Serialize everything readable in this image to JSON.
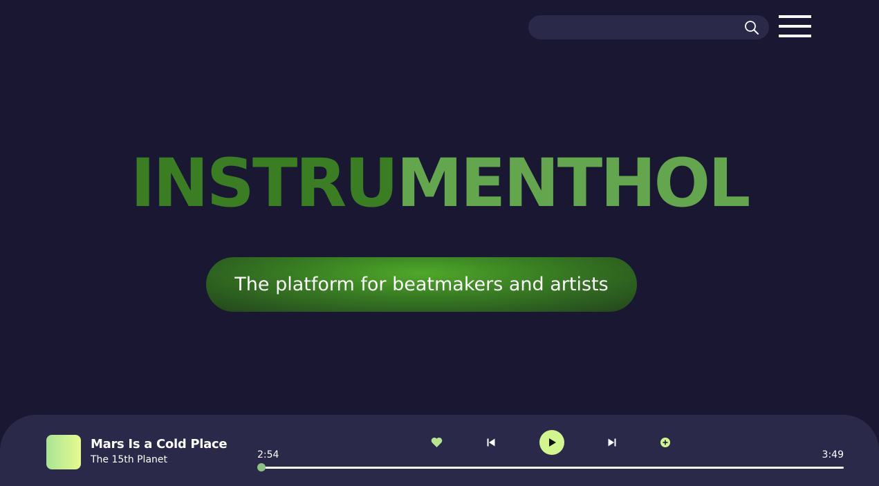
{
  "search": {
    "placeholder": "",
    "value": ""
  },
  "hero": {
    "title_part1": "INSTRU",
    "title_part2": "MENTHOL"
  },
  "tagline": "The platform for beatmakers and artists",
  "player": {
    "track_title": "Mars Is a Cold Place",
    "track_artist": "The 15th Planet",
    "current_time": "2:54",
    "total_time": "3:49",
    "progress": 0
  },
  "colors": {
    "background": "#191732",
    "panel": "#2b2949",
    "title_dark_green": "#3a7d23",
    "title_light_green": "#64a64d",
    "accent_lime": "#d3f58e"
  },
  "icons": {
    "search": "search-icon",
    "menu": "hamburger-menu-icon",
    "like": "heart-icon",
    "previous": "skip-previous-icon",
    "play": "play-icon",
    "next": "skip-next-icon",
    "add": "plus-circle-icon"
  }
}
